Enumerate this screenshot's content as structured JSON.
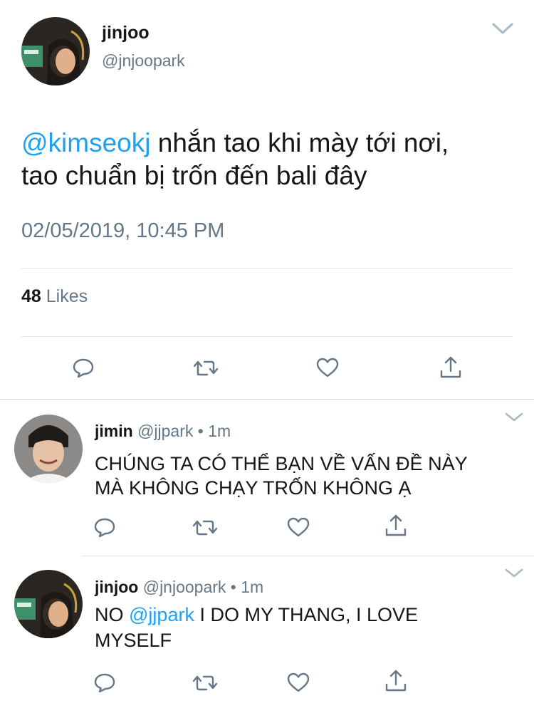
{
  "main_tweet": {
    "display_name": "jinjoo",
    "handle": "@jnjoopark",
    "mention": "@kimseokj",
    "text_line1": " nhắn tao khi mày tới nơi,",
    "text_line2": "tao chuẩn bị trốn đến bali đây",
    "timestamp": "02/05/2019, 10:45 PM",
    "likes_count": "48",
    "likes_label": " Likes"
  },
  "replies": [
    {
      "display_name": "jimin",
      "handle": "@jjpark",
      "separator": " • ",
      "time": "1m",
      "text_line1": "CHÚNG TA CÓ THỂ BẠN VỀ VẤN ĐỀ NÀY",
      "text_line2": "MÀ KHÔNG CHẠY TRỐN KHÔNG Ạ"
    },
    {
      "display_name": "jinjoo",
      "handle": "@jnjoopark",
      "separator": " • ",
      "time": "1m",
      "text_prefix": "NO ",
      "mention": "@jjpark",
      "text_suffix": " I DO MY THANG, I LOVE",
      "text_line2": "MYSELF"
    }
  ],
  "icons": {
    "reply": "speech-bubble-icon",
    "retweet": "retweet-icon",
    "like": "heart-icon",
    "share": "share-icon",
    "menu": "chevron-down-icon"
  },
  "colors": {
    "link": "#1da1f2",
    "muted": "#657786",
    "text": "#14171a",
    "divider": "#e1e8ed"
  }
}
